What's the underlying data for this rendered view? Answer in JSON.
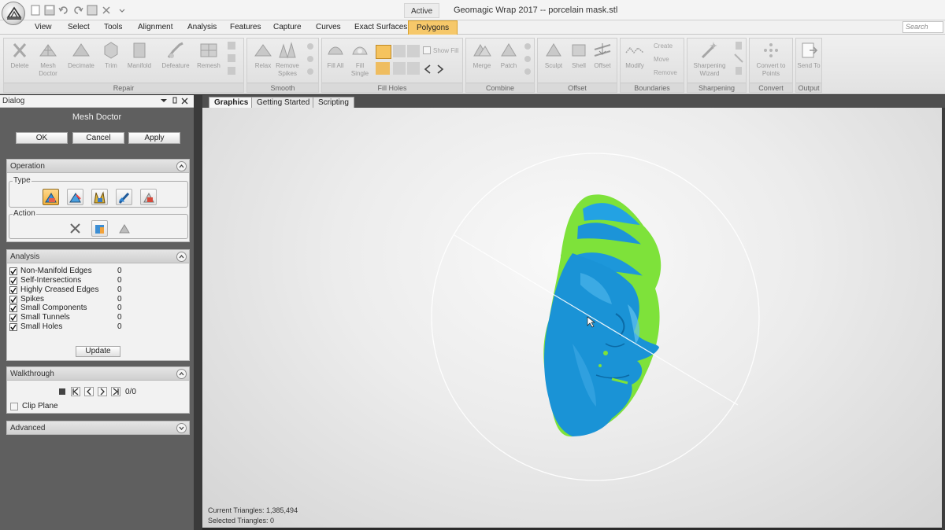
{
  "titlebar": {
    "active_label": "Active",
    "window_title": "Geomagic Wrap 2017 -- porcelain mask.stl"
  },
  "menu": {
    "tabs": [
      "View",
      "Select",
      "Tools",
      "Alignment",
      "Analysis",
      "Features",
      "Capture",
      "Curves",
      "Exact Surfaces",
      "Polygons"
    ],
    "active_tab": "Polygons",
    "search_placeholder": "Search"
  },
  "ribbon": {
    "groups": [
      {
        "label": "Repair",
        "buttons": [
          "Delete",
          "Mesh Doctor",
          "Decimate",
          "Trim",
          "Manifold",
          "Defeature",
          "Remesh"
        ]
      },
      {
        "label": "Smooth",
        "buttons": [
          "Relax",
          "Remove Spikes"
        ]
      },
      {
        "label": "Fill Holes",
        "buttons": [
          "Fill All",
          "Fill Single"
        ],
        "extra": "Show Fill"
      },
      {
        "label": "Combine",
        "buttons": [
          "Merge",
          "Patch"
        ]
      },
      {
        "label": "Offset",
        "buttons": [
          "Sculpt",
          "Shell",
          "Offset"
        ]
      },
      {
        "label": "Boundaries",
        "buttons": [
          "Modify"
        ],
        "small": [
          "Create",
          "Move",
          "Remove"
        ]
      },
      {
        "label": "Sharpening",
        "buttons": [
          "Sharpening Wizard"
        ]
      },
      {
        "label": "Convert",
        "buttons": [
          "Convert to Points"
        ]
      },
      {
        "label": "Output",
        "buttons": [
          "Send To"
        ]
      }
    ]
  },
  "dialog": {
    "header": "Dialog",
    "title": "Mesh Doctor",
    "buttons": {
      "ok": "OK",
      "cancel": "Cancel",
      "apply": "Apply"
    },
    "operation": {
      "label": "Operation",
      "type_label": "Type",
      "action_label": "Action"
    },
    "analysis": {
      "label": "Analysis",
      "items": [
        {
          "label": "Non-Manifold Edges",
          "value": "0",
          "checked": true
        },
        {
          "label": "Self-Intersections",
          "value": "0",
          "checked": true
        },
        {
          "label": "Highly Creased Edges",
          "value": "0",
          "checked": true
        },
        {
          "label": "Spikes",
          "value": "0",
          "checked": true
        },
        {
          "label": "Small Components",
          "value": "0",
          "checked": true
        },
        {
          "label": "Small Tunnels",
          "value": "0",
          "checked": true
        },
        {
          "label": "Small Holes",
          "value": "0",
          "checked": true
        }
      ],
      "update_button": "Update"
    },
    "walkthrough": {
      "label": "Walkthrough",
      "counter": "0/0",
      "clip_plane": "Clip Plane"
    },
    "advanced": {
      "label": "Advanced"
    }
  },
  "viewport": {
    "tabs": [
      "Graphics",
      "Getting Started",
      "Scripting"
    ],
    "active_tab": "Graphics",
    "status_triangles": "Current Triangles: 1,385,494",
    "status_selected": "Selected Triangles: 0"
  },
  "colors": {
    "accent_tab": "#f6c86a",
    "mesh_blue": "#1a93d6",
    "mesh_green": "#6fe02a",
    "panel_bg": "#5f5f5f"
  }
}
